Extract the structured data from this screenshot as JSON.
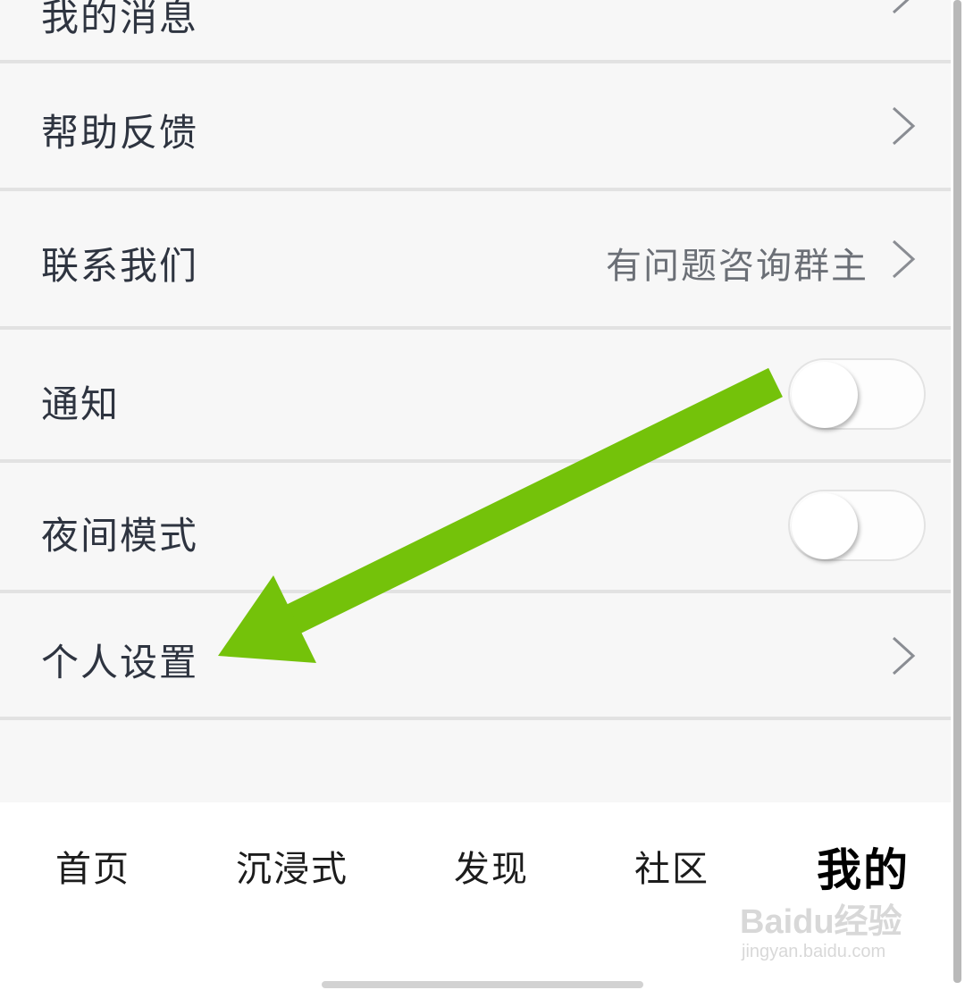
{
  "menu": {
    "items": [
      {
        "label": "我的消息",
        "type": "link"
      },
      {
        "label": "帮助反馈",
        "type": "link"
      },
      {
        "label": "联系我们",
        "type": "link",
        "value": "有问题咨询群主"
      },
      {
        "label": "通知",
        "type": "toggle",
        "on": false
      },
      {
        "label": "夜间模式",
        "type": "toggle",
        "on": false
      },
      {
        "label": "个人设置",
        "type": "link"
      }
    ]
  },
  "tabbar": {
    "tabs": [
      {
        "label": "首页",
        "active": false
      },
      {
        "label": "沉浸式",
        "active": false
      },
      {
        "label": "发现",
        "active": false
      },
      {
        "label": "社区",
        "active": false
      },
      {
        "label": "我的",
        "active": true
      }
    ]
  },
  "watermark": {
    "logo_text": "Baidu经验",
    "url_text": "jingyan.baidu.com"
  },
  "annotation": {
    "arrow_color": "#74c20a",
    "target": "个人设置"
  },
  "colors": {
    "background": "#f7f7f7",
    "divider": "#e2e2e2",
    "label_text": "#2e3440",
    "value_text": "#6b6f76",
    "tabbar_bg": "#ffffff"
  }
}
